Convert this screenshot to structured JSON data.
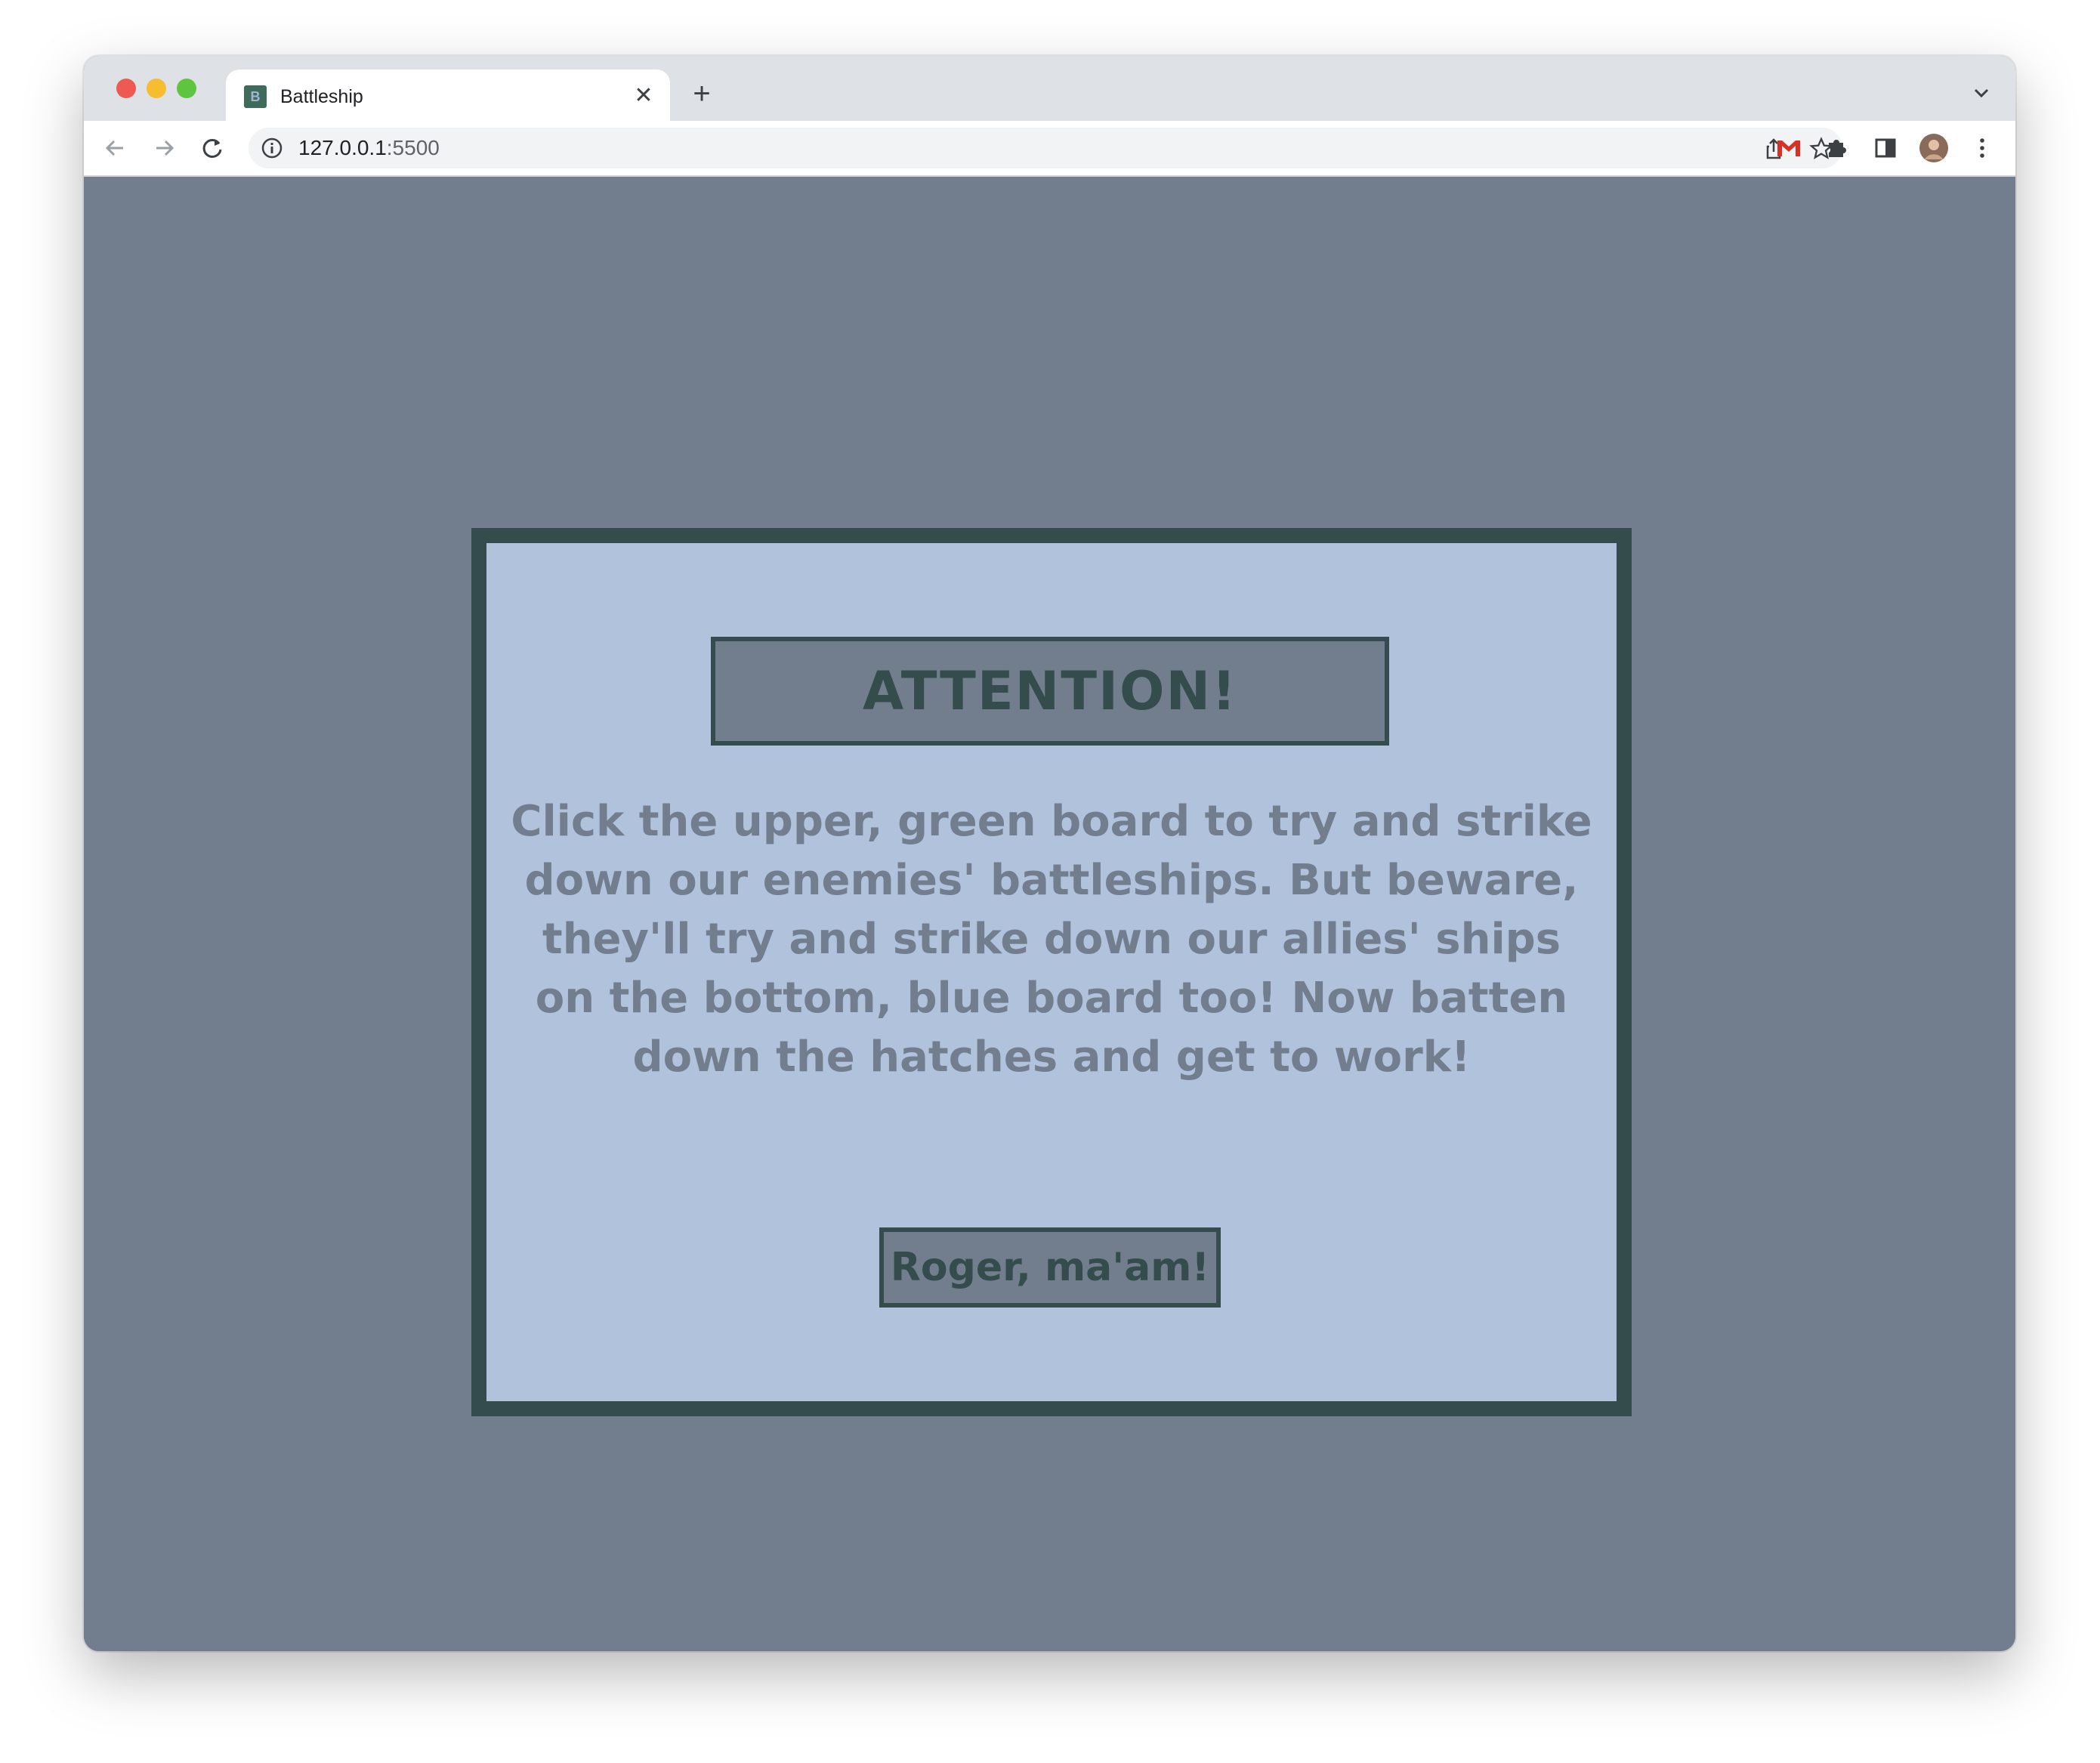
{
  "browser": {
    "tab": {
      "title": "Battleship",
      "favicon_letter": "B",
      "close_glyph": "✕"
    },
    "new_tab_glyph": "+",
    "address": {
      "host": "127.0.0.1",
      "port": ":5500"
    },
    "toolbar_icons": [
      "back-arrow-icon",
      "forward-arrow-icon",
      "reload-icon",
      "site-info-icon",
      "share-icon",
      "bookmark-star-icon",
      "gmail-icon",
      "extensions-icon",
      "side-panel-icon",
      "profile-avatar",
      "menu-kebab-icon"
    ]
  },
  "modal": {
    "title": "ATTENTION!",
    "message": "Click the upper, green board to try and strike down our enemies' battleships. But beware, they'll try and strike down our allies' ships on the bottom, blue board too! Now batten down the hatches and get to work!",
    "button_label": "Roger, ma'am!"
  },
  "colors": {
    "page_background": "#727e8e",
    "modal_background": "#b0c2dc",
    "modal_border": "#344c4c",
    "message_text": "#727e8e"
  }
}
